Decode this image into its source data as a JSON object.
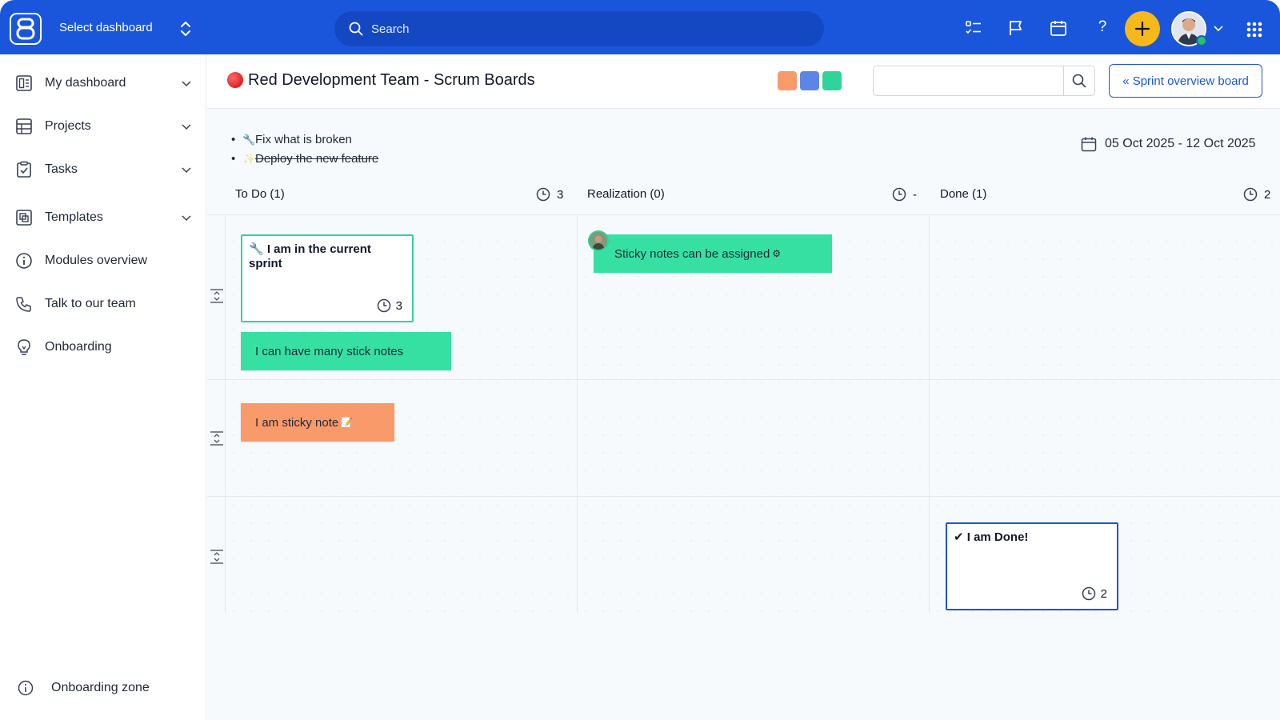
{
  "topbar": {
    "select_dashboard": "Select dashboard",
    "search_placeholder": "Search",
    "help": "?"
  },
  "sidebar": {
    "items": [
      {
        "label": "My dashboard"
      },
      {
        "label": "Projects"
      },
      {
        "label": "Tasks"
      },
      {
        "label": "Templates"
      },
      {
        "label": "Modules overview"
      },
      {
        "label": "Talk to our team"
      },
      {
        "label": "Onboarding"
      }
    ],
    "footer": "Onboarding zone"
  },
  "board": {
    "title": "Red Development Team - Scrum Boards",
    "swatches": [
      "#f99a6b",
      "#5b86e5",
      "#2ed49a"
    ],
    "search_value": "",
    "sprint_button": "« Sprint overview board",
    "goals": [
      {
        "icon": "wrench-icon",
        "glyph": "🔧",
        "text": "Fix what is broken",
        "struck": false
      },
      {
        "icon": "sparkle-icon",
        "glyph": "✨",
        "text": "Deploy the new feature",
        "struck": true
      }
    ],
    "date_range": "05 Oct 2025 - 12 Oct 2025",
    "columns": [
      {
        "title": "To Do (1)",
        "estimate": "3"
      },
      {
        "title": "Realization (0)",
        "estimate": "-"
      },
      {
        "title": "Done (1)",
        "estimate": "2"
      }
    ],
    "cards": [
      {
        "title": "🔧 I am in the current sprint",
        "estimate": "3",
        "border": "#2ed49a"
      },
      {
        "title": "✔ I am Done!",
        "estimate": "2",
        "border": "#1a56db"
      }
    ],
    "notes": [
      {
        "text": "I can have many stick notes",
        "color": "#36e0a3"
      },
      {
        "text": "Sticky notes can be assigned",
        "color": "#36e0a3",
        "trailing_icon": "gear-icon"
      },
      {
        "text": "I am sticky note",
        "color": "#f99a6b",
        "trailing_icon": "note-icon"
      }
    ]
  }
}
